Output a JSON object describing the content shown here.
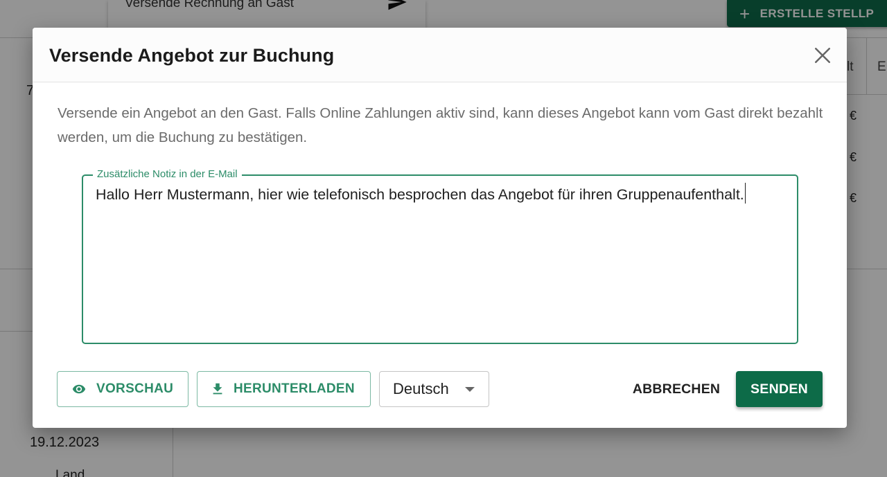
{
  "background": {
    "menu_item_label": "Versende Rechnung an Gast",
    "create_button_label": "ERSTELLE STELLP",
    "left_fragment": "7",
    "header_fragments": [
      "lt",
      "E"
    ],
    "euro_values": [
      "€",
      "€",
      "€"
    ],
    "date": "19.12.2023",
    "field_label": "Land"
  },
  "dialog": {
    "title": "Versende Angebot zur Buchung",
    "description": "Versende ein Angebot an den Gast. Falls Online Zahlungen aktiv sind, kann dieses Angebot kann vom Gast direkt bezahlt werden, um die Buchung zu bestätigen.",
    "note_label": "Zusätzliche Notiz in der E-Mail",
    "note_value": "Hallo Herr Mustermann, hier wie telefonisch besprochen das Angebot für ihren Gruppenaufenthalt.",
    "actions": {
      "preview_label": "VORSCHAU",
      "download_label": "HERUNTERLADEN",
      "language_selected": "Deutsch",
      "cancel_label": "ABBRECHEN",
      "send_label": "SENDEN"
    }
  },
  "colors": {
    "accent": "#2c8c68",
    "primary_button": "#0d6b48"
  },
  "icons": {
    "close": "close-icon",
    "preview": "eye-icon",
    "download": "download-icon",
    "dropdown": "caret-down-icon",
    "send_menu": "send-icon",
    "create": "plus-icon"
  }
}
